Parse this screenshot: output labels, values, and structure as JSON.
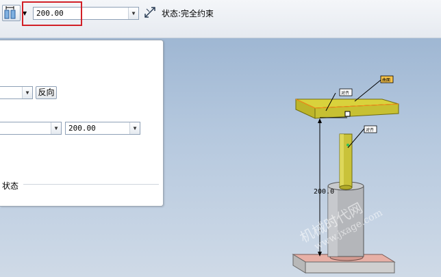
{
  "toolbar": {
    "dimension_value": "200.00",
    "status_text": "状态:完全约束"
  },
  "panel": {
    "flip_button_label": "反向",
    "value_combo_text": "200.00",
    "section_label": "状态"
  },
  "model": {
    "dimension_label": "200.0",
    "tag_top_right": "曲面",
    "tag_left": "对齐",
    "tag_mid": "对齐"
  },
  "watermark": {
    "line1": "机械时代网",
    "line2": "www.jxage.com"
  },
  "icons": [
    "dimension-type-icon",
    "dropdown-arrow-icon",
    "constraint-status-icon"
  ]
}
